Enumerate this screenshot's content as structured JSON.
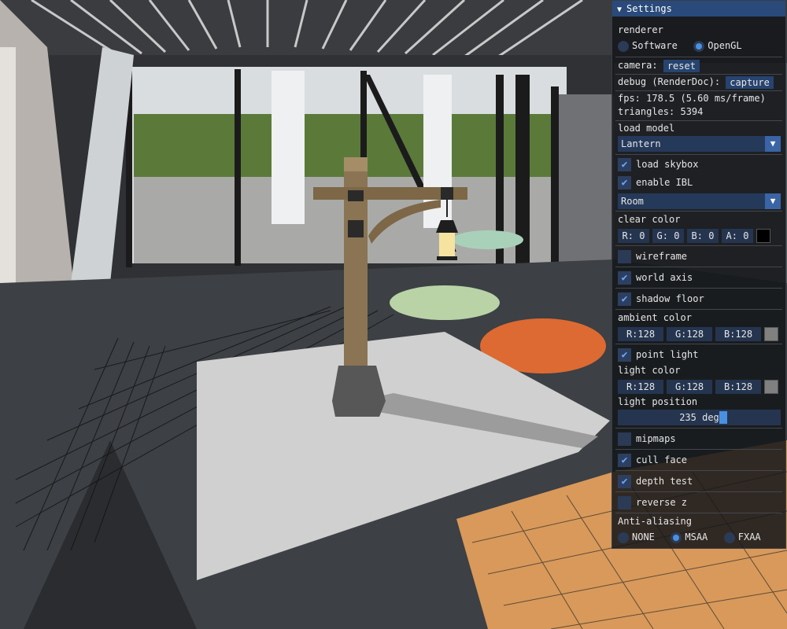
{
  "settings": {
    "title": "Settings",
    "renderer_label": "renderer",
    "renderer_options": [
      "Software",
      "OpenGL"
    ],
    "renderer_selected": "OpenGL",
    "camera_label": "camera:",
    "camera_reset": "reset",
    "debug_label": "debug (RenderDoc):",
    "debug_capture": "capture",
    "fps_text": "fps: 178.5 (5.60 ms/frame)",
    "triangles_text": "triangles: 5394",
    "load_model_label": "load model",
    "model_selected": "Lantern",
    "load_skybox": "load skybox",
    "enable_ibl": "enable IBL",
    "ibl_selected": "Room",
    "clear_color_label": "clear color",
    "clear_color": {
      "r": "R:  0",
      "g": "G:  0",
      "b": "B:  0",
      "a": "A:  0",
      "swatch": "#000000"
    },
    "wireframe": "wireframe",
    "world_axis": "world axis",
    "shadow_floor": "shadow floor",
    "ambient_color_label": "ambient color",
    "ambient_color": {
      "r": "R:128",
      "g": "G:128",
      "b": "B:128",
      "swatch": "#808080"
    },
    "point_light": "point light",
    "light_color_label": "light color",
    "light_color": {
      "r": "R:128",
      "g": "G:128",
      "b": "B:128",
      "swatch": "#808080"
    },
    "light_position_label": "light position",
    "light_position_value": "235 deg",
    "light_position_fraction": 0.653,
    "mipmaps": "mipmaps",
    "cull_face": "cull face",
    "depth_test": "depth test",
    "reverse_z": "reverse z",
    "aa_label": "Anti-aliasing",
    "aa_options": [
      "NONE",
      "MSAA",
      "FXAA"
    ],
    "aa_selected": "MSAA",
    "checks": {
      "load_skybox": true,
      "enable_ibl": true,
      "wireframe": false,
      "world_axis": true,
      "shadow_floor": true,
      "point_light": true,
      "mipmaps": false,
      "cull_face": true,
      "depth_test": true,
      "reverse_z": false
    }
  },
  "colors": {
    "accent": "#4a90e2",
    "title_bar": "#294a7a"
  }
}
